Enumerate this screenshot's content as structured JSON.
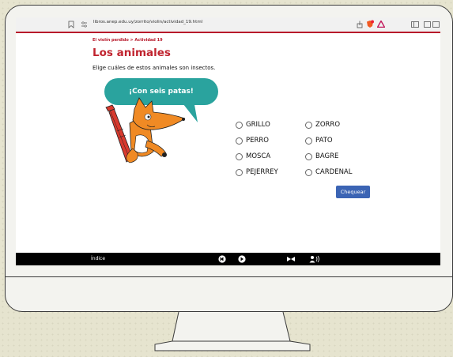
{
  "browser": {
    "url": "libros.anep.edu.uy/zorrito/violin/actividad_19.html"
  },
  "page": {
    "breadcrumb": "El violín perdido > Actividad 19",
    "title": "Los animales",
    "instruction": "Elige cuáles de estos animales son insectos.",
    "bubble_text": "¡Con seis patas!"
  },
  "options": [
    {
      "label": "GRILLO"
    },
    {
      "label": "ZORRO"
    },
    {
      "label": "PERRO"
    },
    {
      "label": "PATO"
    },
    {
      "label": "MOSCA"
    },
    {
      "label": "BAGRE"
    },
    {
      "label": "PEJERREY"
    },
    {
      "label": "CARDENAL"
    }
  ],
  "check_button": "Chequear",
  "bottom": {
    "index_label": "Índice"
  },
  "icons": [
    "bookmark-icon",
    "site-settings-icon",
    "share-icon",
    "brave-shield-icon",
    "brave-rewards-icon",
    "sidebar-icon",
    "wallet-icon",
    "previous-icon",
    "next-icon",
    "bow-icon",
    "audio-icon"
  ],
  "colors": {
    "accent_red": "#c0242f",
    "bubble_teal": "#2aa39e",
    "button_blue": "#3b64b4",
    "bar_black": "#000000"
  }
}
